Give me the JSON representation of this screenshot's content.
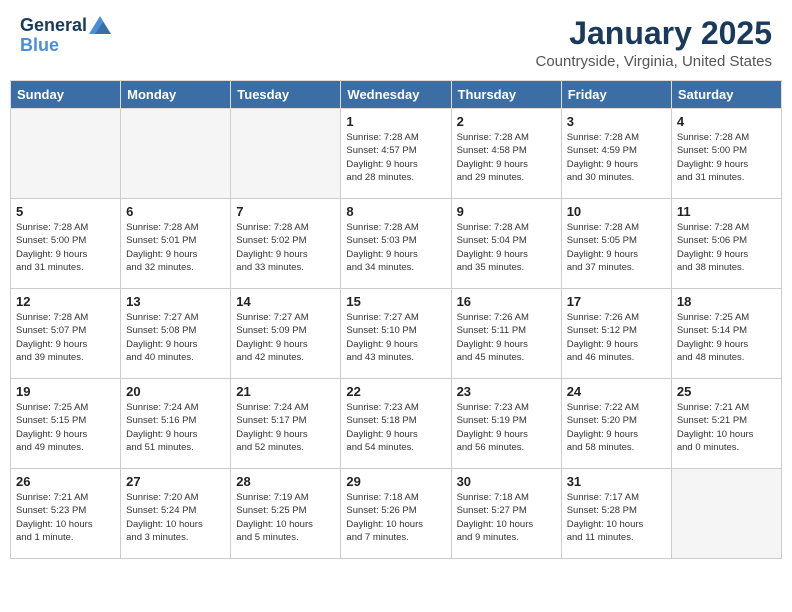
{
  "header": {
    "logo_general": "General",
    "logo_blue": "Blue",
    "month": "January 2025",
    "location": "Countryside, Virginia, United States"
  },
  "days_of_week": [
    "Sunday",
    "Monday",
    "Tuesday",
    "Wednesday",
    "Thursday",
    "Friday",
    "Saturday"
  ],
  "weeks": [
    [
      {
        "day": "",
        "info": "",
        "empty": true
      },
      {
        "day": "",
        "info": "",
        "empty": true
      },
      {
        "day": "",
        "info": "",
        "empty": true
      },
      {
        "day": "1",
        "info": "Sunrise: 7:28 AM\nSunset: 4:57 PM\nDaylight: 9 hours\nand 28 minutes."
      },
      {
        "day": "2",
        "info": "Sunrise: 7:28 AM\nSunset: 4:58 PM\nDaylight: 9 hours\nand 29 minutes."
      },
      {
        "day": "3",
        "info": "Sunrise: 7:28 AM\nSunset: 4:59 PM\nDaylight: 9 hours\nand 30 minutes."
      },
      {
        "day": "4",
        "info": "Sunrise: 7:28 AM\nSunset: 5:00 PM\nDaylight: 9 hours\nand 31 minutes."
      }
    ],
    [
      {
        "day": "5",
        "info": "Sunrise: 7:28 AM\nSunset: 5:00 PM\nDaylight: 9 hours\nand 31 minutes."
      },
      {
        "day": "6",
        "info": "Sunrise: 7:28 AM\nSunset: 5:01 PM\nDaylight: 9 hours\nand 32 minutes."
      },
      {
        "day": "7",
        "info": "Sunrise: 7:28 AM\nSunset: 5:02 PM\nDaylight: 9 hours\nand 33 minutes."
      },
      {
        "day": "8",
        "info": "Sunrise: 7:28 AM\nSunset: 5:03 PM\nDaylight: 9 hours\nand 34 minutes."
      },
      {
        "day": "9",
        "info": "Sunrise: 7:28 AM\nSunset: 5:04 PM\nDaylight: 9 hours\nand 35 minutes."
      },
      {
        "day": "10",
        "info": "Sunrise: 7:28 AM\nSunset: 5:05 PM\nDaylight: 9 hours\nand 37 minutes."
      },
      {
        "day": "11",
        "info": "Sunrise: 7:28 AM\nSunset: 5:06 PM\nDaylight: 9 hours\nand 38 minutes."
      }
    ],
    [
      {
        "day": "12",
        "info": "Sunrise: 7:28 AM\nSunset: 5:07 PM\nDaylight: 9 hours\nand 39 minutes."
      },
      {
        "day": "13",
        "info": "Sunrise: 7:27 AM\nSunset: 5:08 PM\nDaylight: 9 hours\nand 40 minutes."
      },
      {
        "day": "14",
        "info": "Sunrise: 7:27 AM\nSunset: 5:09 PM\nDaylight: 9 hours\nand 42 minutes."
      },
      {
        "day": "15",
        "info": "Sunrise: 7:27 AM\nSunset: 5:10 PM\nDaylight: 9 hours\nand 43 minutes."
      },
      {
        "day": "16",
        "info": "Sunrise: 7:26 AM\nSunset: 5:11 PM\nDaylight: 9 hours\nand 45 minutes."
      },
      {
        "day": "17",
        "info": "Sunrise: 7:26 AM\nSunset: 5:12 PM\nDaylight: 9 hours\nand 46 minutes."
      },
      {
        "day": "18",
        "info": "Sunrise: 7:25 AM\nSunset: 5:14 PM\nDaylight: 9 hours\nand 48 minutes."
      }
    ],
    [
      {
        "day": "19",
        "info": "Sunrise: 7:25 AM\nSunset: 5:15 PM\nDaylight: 9 hours\nand 49 minutes."
      },
      {
        "day": "20",
        "info": "Sunrise: 7:24 AM\nSunset: 5:16 PM\nDaylight: 9 hours\nand 51 minutes."
      },
      {
        "day": "21",
        "info": "Sunrise: 7:24 AM\nSunset: 5:17 PM\nDaylight: 9 hours\nand 52 minutes."
      },
      {
        "day": "22",
        "info": "Sunrise: 7:23 AM\nSunset: 5:18 PM\nDaylight: 9 hours\nand 54 minutes."
      },
      {
        "day": "23",
        "info": "Sunrise: 7:23 AM\nSunset: 5:19 PM\nDaylight: 9 hours\nand 56 minutes."
      },
      {
        "day": "24",
        "info": "Sunrise: 7:22 AM\nSunset: 5:20 PM\nDaylight: 9 hours\nand 58 minutes."
      },
      {
        "day": "25",
        "info": "Sunrise: 7:21 AM\nSunset: 5:21 PM\nDaylight: 10 hours\nand 0 minutes."
      }
    ],
    [
      {
        "day": "26",
        "info": "Sunrise: 7:21 AM\nSunset: 5:23 PM\nDaylight: 10 hours\nand 1 minute."
      },
      {
        "day": "27",
        "info": "Sunrise: 7:20 AM\nSunset: 5:24 PM\nDaylight: 10 hours\nand 3 minutes."
      },
      {
        "day": "28",
        "info": "Sunrise: 7:19 AM\nSunset: 5:25 PM\nDaylight: 10 hours\nand 5 minutes."
      },
      {
        "day": "29",
        "info": "Sunrise: 7:18 AM\nSunset: 5:26 PM\nDaylight: 10 hours\nand 7 minutes."
      },
      {
        "day": "30",
        "info": "Sunrise: 7:18 AM\nSunset: 5:27 PM\nDaylight: 10 hours\nand 9 minutes."
      },
      {
        "day": "31",
        "info": "Sunrise: 7:17 AM\nSunset: 5:28 PM\nDaylight: 10 hours\nand 11 minutes."
      },
      {
        "day": "",
        "info": "",
        "empty": true
      }
    ]
  ]
}
